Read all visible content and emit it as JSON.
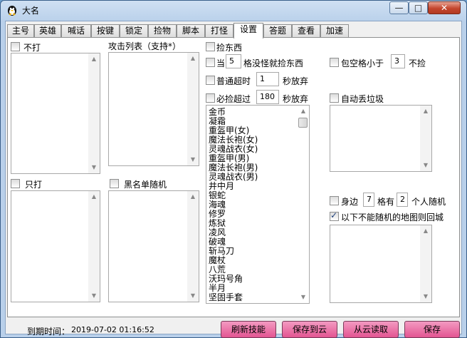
{
  "window": {
    "title": "大名",
    "min_label": "—",
    "max_label": "□",
    "close_label": "✕"
  },
  "tabs": [
    "主号",
    "英雄",
    "喊话",
    "按键",
    "锁定",
    "捡物",
    "脚本",
    "打怪",
    "设置",
    "答题",
    "查看",
    "加速"
  ],
  "active_tab": "设置",
  "left": {
    "no_attack_label": "不打",
    "attack_list_label": "攻击列表（支持*）",
    "only_attack_label": "只打",
    "blacklist_random_label": "黑名单随机"
  },
  "pickup": {
    "pick_items_label": "捡东西",
    "when_label": "当",
    "when_value": "5",
    "no_monster_label": "格没怪就捡东西",
    "normal_timeout_label": "普通超时",
    "normal_timeout_value": "1",
    "seconds_giveup_1": "秒放弃",
    "must_pick_label": "必捡超过",
    "must_pick_value": "180",
    "seconds_giveup_2": "秒放弃",
    "items": [
      "金币",
      "凝霜",
      "重盔甲(女)",
      "魔法长袍(女)",
      "灵魂战衣(女)",
      "重盔甲(男)",
      "魔法长袍(男)",
      "灵魂战衣(男)",
      "井中月",
      "银蛇",
      "海魂",
      "修罗",
      "炼狱",
      "凌风",
      "破魂",
      "斩马刀",
      "魔杖",
      "八荒",
      "沃玛号角",
      "半月",
      "坚固手套"
    ]
  },
  "right": {
    "bag_space_label": "包空格小于",
    "bag_space_value": "3",
    "no_pick_label": "不捡",
    "auto_drop_label": "自动丢垃圾",
    "nearby_label": "身边",
    "nearby_value": "7",
    "grid_has_label": "格有",
    "grid_has_value": "2",
    "people_random_label": "个人随机",
    "no_random_label": "以下不能随机的地图则回城",
    "no_random_checked": true
  },
  "footer": {
    "expire_label": "到期时间：",
    "expire_value": "2019-07-02 01:16:52",
    "refresh_skill": "刷新技能",
    "save_cloud": "保存到云",
    "read_cloud": "从云读取",
    "save": "保存"
  },
  "colors": {
    "button_pink": "#e35592",
    "titlebar": "#b9d0ea"
  }
}
